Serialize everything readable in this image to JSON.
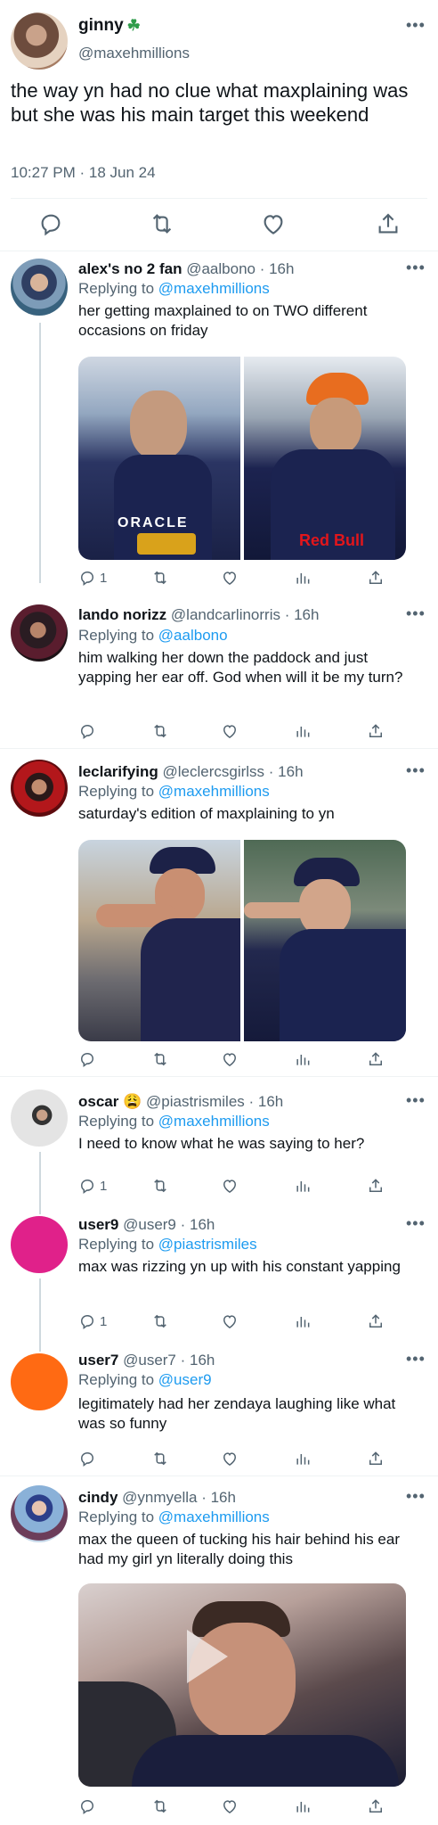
{
  "main_tweet": {
    "name": "ginny",
    "emoji": "☘",
    "handle": "@maxehmillions",
    "text": "the way yn had no clue what maxplaining was but she was his main target this weekend",
    "timestamp": "10:27 PM · 18 Jun 24"
  },
  "replies": [
    {
      "name": "alex's no 2 fan",
      "handle": "@aalbono · 16h",
      "replying_label": "Replying to",
      "replying_to": "@maxehmillions",
      "text": "her getting maxplained to on TWO different occasions on friday",
      "reply_count": "1",
      "image_text": {
        "left_logo": "ORACLE",
        "right_logo": "Red Bull"
      }
    },
    {
      "name": "lando norizz",
      "handle": "@landcarlinorris · 16h",
      "replying_label": "Replying to",
      "replying_to": "@aalbono",
      "text": "him walking her down the paddock and just yapping her ear off. God when will it be my turn?",
      "reply_count": ""
    },
    {
      "name": "leclarifying",
      "handle": "@leclercsgirlss · 16h",
      "replying_label": "Replying to",
      "replying_to": "@maxehmillions",
      "text": "saturday's edition of maxplaining to yn",
      "reply_count": ""
    },
    {
      "name": "oscar",
      "emoji": "😩",
      "handle": "@piastrismiles · 16h",
      "replying_label": "Replying to",
      "replying_to": "@maxehmillions",
      "text": "I need to know what he was saying to her?",
      "reply_count": "1"
    },
    {
      "name": "user9",
      "handle": "@user9 · 16h",
      "replying_label": "Replying to",
      "replying_to": "@piastrismiles",
      "text": "max was rizzing yn up with his constant yapping",
      "reply_count": "1"
    },
    {
      "name": "user7",
      "handle": "@user7 · 16h",
      "replying_label": "Replying to",
      "replying_to": "@user9",
      "text": "legitimately had her zendaya laughing like what was so funny",
      "reply_count": ""
    },
    {
      "name": "cindy",
      "handle": "@ynmyella · 16h",
      "replying_label": "Replying to",
      "replying_to": "@maxehmillions",
      "text": "max the queen of tucking his hair behind his ear had my girl yn literally doing this",
      "reply_count": ""
    }
  ],
  "icons": {
    "reply": "reply-icon",
    "retweet": "retweet-icon",
    "like": "heart-icon",
    "views": "views-icon",
    "share": "share-icon",
    "more": "more-icon"
  },
  "colors": {
    "link": "#1d9bf0",
    "secondary_text": "#536471",
    "divider": "#eff3f4",
    "thread_line": "#cfd9de",
    "user9_avatar": "#e0218a",
    "user7_avatar": "#ff6a13"
  }
}
